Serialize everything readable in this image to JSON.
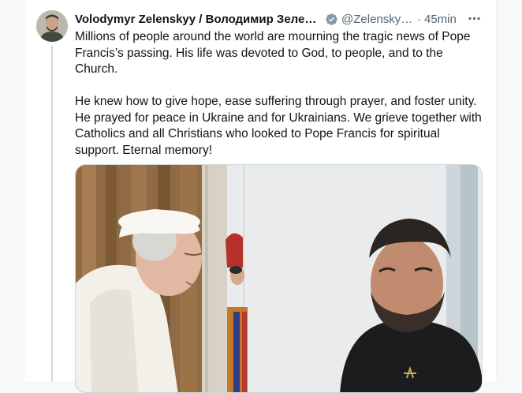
{
  "post": {
    "author_name": "Volodymyr Zelenskyy / Володимир Зеленський",
    "handle": "@ZelenskyyUa",
    "separator": "·",
    "timestamp": "45min",
    "more_icon": "more-horizontal-icon",
    "verified_icon": "verified-badge-icon",
    "paragraphs": [
      "Millions of people around the world are mourning the tragic news of Pope Francis’s passing. His life was devoted to God, to people, and to the Church.",
      "He knew how to give hope, ease suffering through prayer, and foster unity. He prayed for peace in Ukraine and for Ukrainians. We grieve together with Catholics and all Christians who looked to Pope Francis for spiritual support. Eternal memory!"
    ]
  },
  "colors": {
    "verified": "#1d9bf0",
    "secondary_text": "#536471",
    "thread_line": "#cfd9de"
  }
}
